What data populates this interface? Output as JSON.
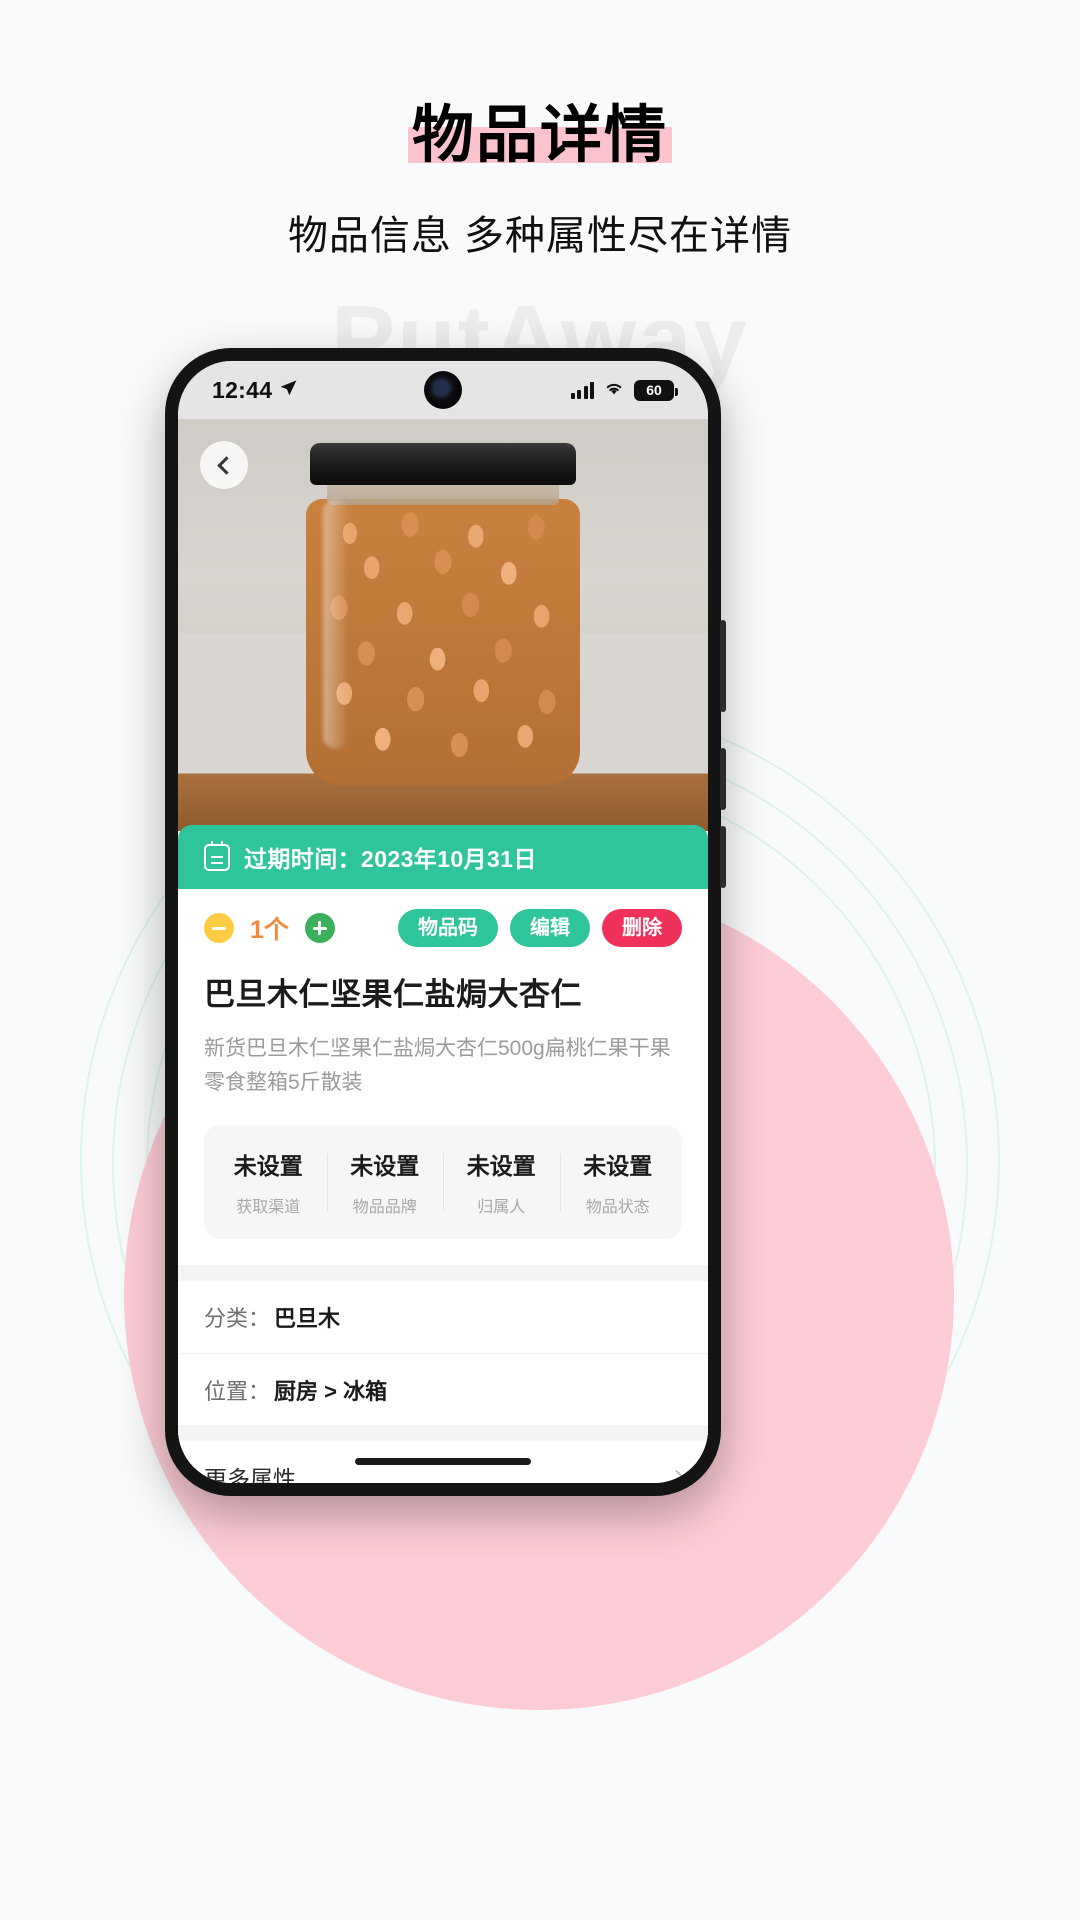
{
  "header": {
    "title": "物品详情",
    "subtitle": "物品信息 多种属性尽在详情",
    "highlight_color": "#fac3ce"
  },
  "background": {
    "watermark": "PutAway",
    "pink_circle_color": "#fdccd6",
    "ring_color": "#dff3ec"
  },
  "phone": {
    "status_bar": {
      "time": "12:44",
      "location_icon": "location-arrow-icon",
      "signal_icon": "signal-bars-icon",
      "wifi_icon": "wifi-icon",
      "battery_level": "60"
    },
    "home_indicator": "home-indicator"
  },
  "screen": {
    "back_icon": "chevron-left-icon",
    "hero_image_alt": "almond-jar-photo",
    "expiry": {
      "icon": "calendar-icon",
      "text": "过期时间：2023年10月31日",
      "bg_color": "#2ec49c"
    },
    "quantity": {
      "decrement_icon": "minus-circle-icon",
      "value": "1个",
      "increment_icon": "plus-circle-icon",
      "value_color": "#f08a3c",
      "minus_color": "#ffcc44",
      "plus_color": "#3cb05a"
    },
    "actions": [
      {
        "label": "物品码",
        "color": "#2ec49c"
      },
      {
        "label": "编辑",
        "color": "#2ec49c"
      },
      {
        "label": "删除",
        "color": "#f0315c"
      }
    ],
    "item": {
      "title": "巴旦木仁坚果仁盐焗大杏仁",
      "description": "新货巴旦木仁坚果仁盐焗大杏仁500g扁桃仁果干果零食整箱5斤散装"
    },
    "attributes": [
      {
        "value": "未设置",
        "label": "获取渠道"
      },
      {
        "value": "未设置",
        "label": "物品品牌"
      },
      {
        "value": "未设置",
        "label": "归属人"
      },
      {
        "value": "未设置",
        "label": "物品状态"
      }
    ],
    "rows": [
      {
        "label": "分类：",
        "value": "巴旦木"
      },
      {
        "label": "位置：",
        "value": "厨房 > 冰箱"
      }
    ],
    "more": {
      "label": "更多属性",
      "chevron_icon": "chevron-right-icon"
    }
  }
}
